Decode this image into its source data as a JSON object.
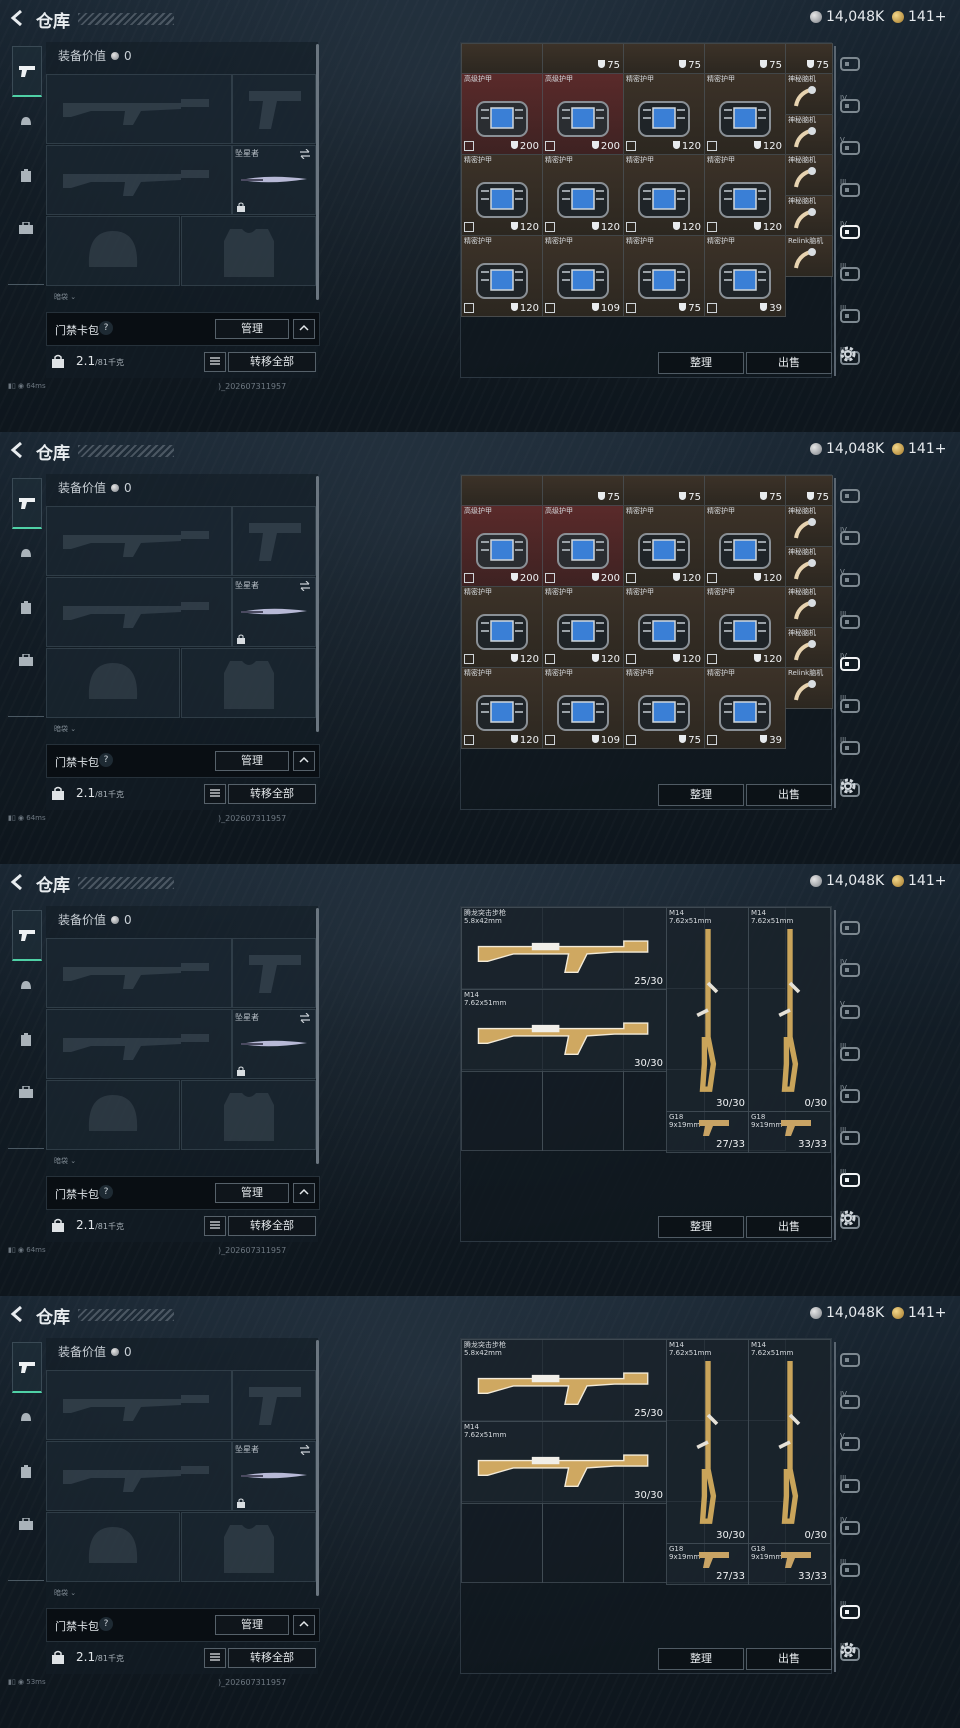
{
  "frames": [
    {
      "variant": "armor",
      "status": {
        "ping": "64ms",
        "build": ")_202607311957"
      }
    },
    {
      "variant": "armor",
      "status": {
        "ping": "64ms",
        "build": ")_202607311957"
      }
    },
    {
      "variant": "guns",
      "status": {
        "ping": "64ms",
        "build": ")_202607311957"
      }
    },
    {
      "variant": "guns",
      "status": {
        "ping": "53ms",
        "build": ")_202607311957"
      }
    }
  ],
  "header": {
    "title": "仓库",
    "silver": "14,048K",
    "gold": "141+"
  },
  "equipment": {
    "value_label": "装备价值",
    "value": "0",
    "melee_name": "坠星者",
    "pocket_label": "暗袋 ⌄",
    "bag_label": "门禁卡包",
    "help": "?",
    "manage": "管理",
    "weight": "2.1",
    "weight_max": "/81千克",
    "transfer_all": "转移全部"
  },
  "stash_armor": {
    "top_values": [
      "75",
      "75",
      "75"
    ],
    "rows": [
      [
        {
          "name": "高级护甲",
          "val": "200",
          "kind": "red"
        },
        {
          "name": "高级护甲",
          "val": "200",
          "kind": "red"
        },
        {
          "name": "精密护甲",
          "val": "120",
          "kind": "brown"
        },
        {
          "name": "精密护甲",
          "val": "120",
          "kind": "brown"
        },
        {
          "name": "神秘脑机",
          "val": "",
          "kind": "brown"
        }
      ],
      [
        {
          "name": "精密护甲",
          "val": "120",
          "kind": "brown"
        },
        {
          "name": "精密护甲",
          "val": "120",
          "kind": "brown"
        },
        {
          "name": "精密护甲",
          "val": "120",
          "kind": "brown"
        },
        {
          "name": "精密护甲",
          "val": "120",
          "kind": "brown"
        },
        {
          "name": "神秘脑机",
          "val": "",
          "kind": "brown"
        }
      ],
      [
        {
          "name": "精密护甲",
          "val": "120",
          "kind": "brown"
        },
        {
          "name": "精密护甲",
          "val": "109",
          "kind": "brown"
        },
        {
          "name": "精密护甲",
          "val": "75",
          "kind": "brown"
        },
        {
          "name": "精密护甲",
          "val": "39",
          "kind": "brown"
        },
        {
          "name": "Relink脑机",
          "val": "",
          "kind": "brown"
        }
      ]
    ],
    "extra_labels": [
      "神秘脑机",
      "神秘脑机"
    ]
  },
  "stash_guns": {
    "items": [
      {
        "name": "腾龙突击步枪",
        "sub": "5.8x42mm",
        "ammo": "25/30"
      },
      {
        "name": "M14",
        "sub": "7.62x51mm",
        "ammo": "30/30"
      },
      {
        "name": "M14",
        "sub": "7.62x51mm",
        "ammo": "30/30"
      },
      {
        "name": "M14",
        "sub": "7.62x51mm",
        "ammo": "0/30"
      },
      {
        "name": "G18",
        "sub": "9x19mm",
        "ammo": "27/33"
      },
      {
        "name": "G18",
        "sub": "9x19mm",
        "ammo": "33/33"
      }
    ]
  },
  "buttons": {
    "sort": "整理",
    "sell": "出售"
  },
  "rightnav": [
    "",
    "IV",
    "V",
    "III",
    "IV",
    "III",
    "III",
    "III"
  ]
}
